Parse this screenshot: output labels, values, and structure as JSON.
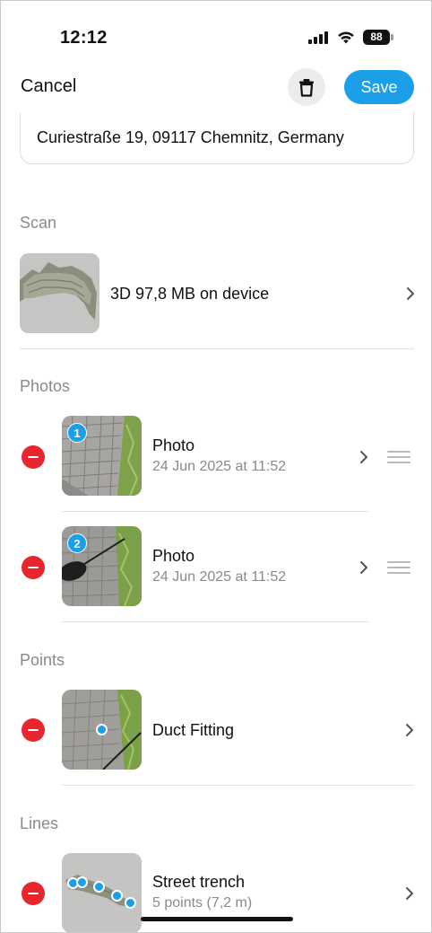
{
  "status_bar": {
    "time": "12:12",
    "battery": "88"
  },
  "nav": {
    "cancel_label": "Cancel",
    "save_label": "Save",
    "delete_icon": "trash-icon"
  },
  "address": {
    "value": "Curiestraße 19, 09117 Chemnitz, Germany"
  },
  "scan": {
    "section_label": "Scan",
    "item_label": "3D 97,8 MB on device"
  },
  "photos": {
    "section_label": "Photos",
    "items": [
      {
        "badge": "1",
        "title": "Photo",
        "date": "24 Jun 2025 at 11:52"
      },
      {
        "badge": "2",
        "title": "Photo",
        "date": "24 Jun 2025 at 11:52"
      }
    ]
  },
  "points": {
    "section_label": "Points",
    "items": [
      {
        "title": "Duct Fitting"
      }
    ]
  },
  "lines": {
    "section_label": "Lines",
    "items": [
      {
        "title": "Street trench",
        "subtitle": "5 points (7,2 m)"
      }
    ]
  },
  "colors": {
    "accent": "#1a9fe8",
    "destructive": "#e8262d",
    "secondary_text": "#8a8a8a"
  }
}
